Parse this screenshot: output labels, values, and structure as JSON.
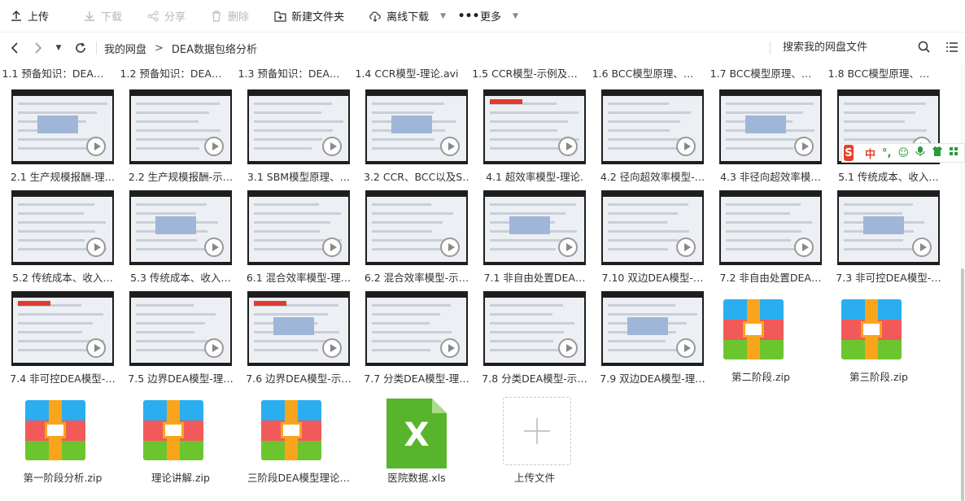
{
  "toolbar": {
    "upload": "上传",
    "download": "下载",
    "share": "分享",
    "delete": "删除",
    "new_folder": "新建文件夹",
    "offline": "离线下载",
    "more": "更多"
  },
  "nav": {
    "crumb_root": "我的网盘",
    "crumb_current": "DEA数据包络分析",
    "search_label": "搜索我的网盘文件"
  },
  "top_row_labels": [
    "1.1 预备知识：DEA…",
    "1.2 预备知识：DEA…",
    "1.3 预备知识：DEA…",
    "1.4 CCR模型-理论.avi",
    "1.5 CCR模型-示例及…",
    "1.6 BCC模型原理、…",
    "1.7 BCC模型原理、…",
    "1.8 BCC模型原理、…"
  ],
  "videos": [
    "2.1 生产规模报酬-理…",
    "2.2 生产规模报酬-示…",
    "3.1 SBM模型原理、…",
    "3.2 CCR、BCC以及S…",
    "4.1 超效率模型-理论.",
    "4.2 径向超效率模型-…",
    "4.3 非径向超效率模…",
    "5.1 传统成本、收入…",
    "5.2 传统成本、收入…",
    "5.3 传统成本、收入…",
    "6.1 混合效率模型-理…",
    "6.2 混合效率模型-示…",
    "7.1 非自由处置DEA…",
    "7.10 双边DEA模型-…",
    "7.2 非自由处置DEA…",
    "7.3 非可控DEA模型-…",
    "7.4 非可控DEA模型-…",
    "7.5 边界DEA模型-理…",
    "7.6 边界DEA模型-示…",
    "7.7 分类DEA模型-理…",
    "7.8 分类DEA模型-示…",
    "7.9 双边DEA模型-理…"
  ],
  "archives_row3": [
    "第二阶段.zip",
    "第三阶段.zip"
  ],
  "archives_row4": [
    "第一阶段分析.zip",
    "理论讲解.zip",
    "三阶段DEA模型理论…"
  ],
  "spreadsheet": {
    "name": "医院数据.xls",
    "glyph": "X"
  },
  "upload_tile": "上传文件",
  "ime": {
    "logo": "S",
    "mode": "中",
    "punct": "°,"
  },
  "colors": {
    "zip_blue": "#2aaef0",
    "zip_red": "#f25a5a",
    "zip_green": "#6cc52f",
    "zip_strap": "#f8a51c",
    "xls_green": "#58b52b"
  }
}
